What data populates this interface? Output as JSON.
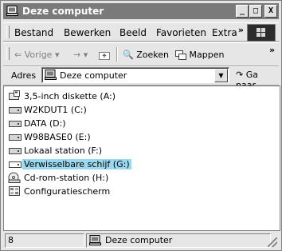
{
  "window": {
    "title": "Deze computer"
  },
  "titlebar_buttons": {
    "minimize": "_",
    "maximize": "□",
    "close": "X"
  },
  "menu": {
    "items": [
      "Bestand",
      "Bewerken",
      "Beeld",
      "Favorieten",
      "Extra"
    ],
    "more": "»"
  },
  "toolbar": {
    "back": "Vorige",
    "forward_arrow": "→",
    "search": "Zoeken",
    "folders": "Mappen",
    "more": "»"
  },
  "address": {
    "label": "Adres",
    "value": "Deze computer",
    "go": "Ga naar"
  },
  "items": [
    {
      "label": "3,5-inch diskette (A:)",
      "icon": "floppy-icon"
    },
    {
      "label": "W2KDUT1 (C:)",
      "icon": "hard-drive-icon"
    },
    {
      "label": "DATA (D:)",
      "icon": "hard-drive-icon"
    },
    {
      "label": "W98BASE0 (E:)",
      "icon": "hard-drive-icon"
    },
    {
      "label": "Lokaal station (F:)",
      "icon": "hard-drive-icon"
    },
    {
      "label": "Verwisselbare schijf (G:)",
      "icon": "removable-drive-icon",
      "selected": true
    },
    {
      "label": "Cd-rom-station (H:)",
      "icon": "cdrom-icon"
    },
    {
      "label": "Configuratiescherm",
      "icon": "control-panel-icon"
    }
  ],
  "status": {
    "count": "8",
    "location": "Deze computer"
  },
  "colors": {
    "selection": "#9ad8f0",
    "titlebar": "#7a7a7a"
  }
}
